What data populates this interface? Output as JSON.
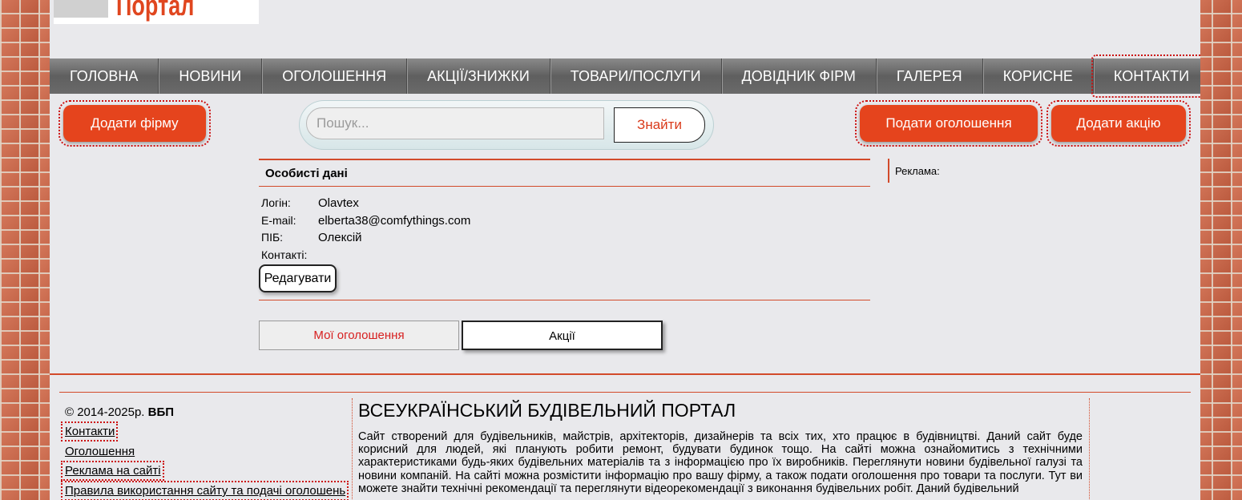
{
  "header": {
    "logo_text": "Портал"
  },
  "nav": {
    "items": [
      "ГОЛОВНА",
      "НОВИНИ",
      "ОГОЛОШЕННЯ",
      "АКЦІЇ/ЗНИЖКИ",
      "ТОВАРИ/ПОСЛУГИ",
      "ДОВІДНИК ФІРМ",
      "ГАЛЕРЕЯ",
      "КОРИСНЕ",
      "КОНТАКТИ"
    ],
    "active": "КОНТАКТИ"
  },
  "actions": {
    "add_firm": "Додати фірму",
    "submit_ad": "Подати оголошення",
    "add_promo": "Додати акцію"
  },
  "search": {
    "placeholder": "Пошук...",
    "value": "",
    "button": "Знайти"
  },
  "profile": {
    "title": "Особисті дані",
    "login_label": "Логін:",
    "login_value": "Olavtex",
    "email_label": "E-mail:",
    "email_value": "elberta38@comfythings.com",
    "name_label": "ПІБ:",
    "name_value": "Олексій",
    "contacts_label": "Контакті:",
    "edit_button": "Редагувати"
  },
  "tabs": {
    "my_ads": "Мої оголошення",
    "promos": "Акції"
  },
  "sidebar": {
    "ad_label": "Реклама:"
  },
  "footer": {
    "copyright_prefix": "© 2014-2025р.",
    "copyright_brand": "ВБП",
    "links": [
      "Контакти",
      "Оголошення",
      "Реклама на сайті",
      "Правила використання сайту та подачі оголошень"
    ],
    "about_title": "ВСЕУКРАЇНСЬКИЙ БУДІВЕЛЬНИЙ ПОРТАЛ",
    "about_text": "Сайт створений для будівельників, майстрів, архітекторів, дизайнерів та всіх тих, хто працює в будівництві. Даний сайт буде корисний для людей, які планують робити ремонт, будувати будинок тощо. На сайті можна ознайомитись з технічними характеристиками будь-яких будівельних матеріалів та з інформацією про їх виробників. Переглянути новини будівельної галузі та новини компаній. На сайті можна розмістити інформацію про вашу фірму, а також подати оголошення про товари та послуги. Тут ви можете знайти технічні рекомендації та переглянути відеорекомендації з виконання будівельних робіт. Даний будівельний"
  },
  "colors": {
    "accent": "#e5441d",
    "nav_bg": "#6a6a6a",
    "page_bg": "#e9e9ec",
    "line": "#d24a2a"
  }
}
